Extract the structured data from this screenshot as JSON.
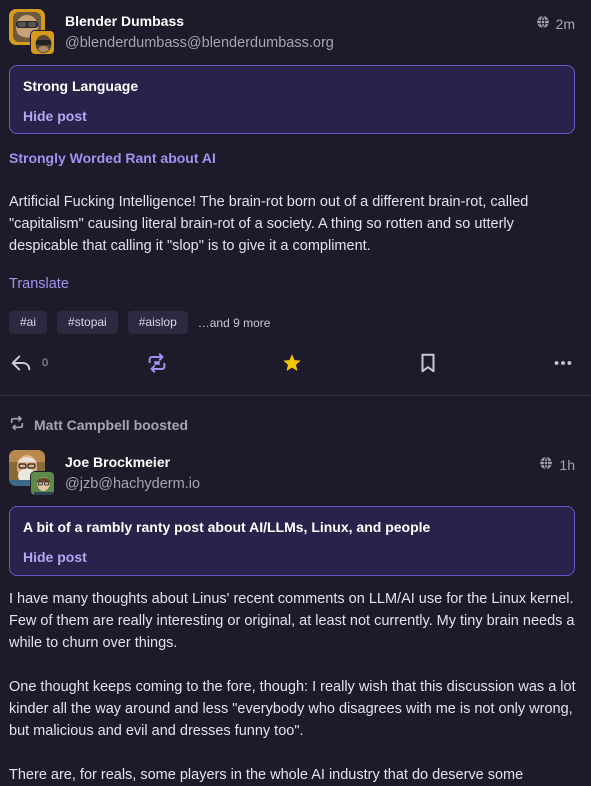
{
  "posts": [
    {
      "display_name": "Blender Dumbass",
      "handle": "@blenderdumbass@blenderdumbass.org",
      "visibility_icon": "globe-icon",
      "time": "2m",
      "content_warning": "Strong Language",
      "hide_label": "Hide post",
      "title": "Strongly Worded Rant about AI",
      "body_paragraphs": [
        "Artificial Fucking Intelligence! The brain-rot born out of a different brain-rot, called \"capitalism\" causing literal brain-rot of a society. A thing so rotten and so utterly despicable that calling it \"slop\" is to give it a compliment."
      ],
      "translate_label": "Translate",
      "tags": [
        "#ai",
        "#stopai",
        "#aislop"
      ],
      "more_tags": "…and 9 more",
      "reply_count": "0",
      "actions": {
        "reply_icon": "reply-icon",
        "boost_icon": "boost-icon",
        "favorite_icon": "star-icon",
        "bookmark_icon": "bookmark-icon",
        "more_icon": "more-icon"
      },
      "favorited": true
    },
    {
      "boosted_by": "Matt Campbell boosted",
      "display_name": "Joe Brockmeier",
      "handle": "@jzb@hachyderm.io",
      "visibility_icon": "globe-icon",
      "time": "1h",
      "content_warning": "A bit of a rambly ranty post about AI/LLMs, Linux, and people",
      "hide_label": "Hide post",
      "body_paragraphs": [
        "I have many thoughts about Linus' recent comments on LLM/AI use for the Linux kernel. Few of them are really interesting or original, at least not currently. My tiny brain needs a while to churn over things.",
        "One thought keeps coming to the fore, though: I really wish that this discussion was a lot kinder all the way around and less \"everybody who disagrees with me is not only wrong, but malicious and evil and dresses funny too\".",
        "There are, for reals, some players in the whole AI industry that do deserve some"
      ]
    }
  ],
  "colors": {
    "background": "#1d1b29",
    "accent": "#9e93f2",
    "favorite": "#f5c400",
    "cw_border": "#6c55c6",
    "cw_background": "#29224a"
  }
}
